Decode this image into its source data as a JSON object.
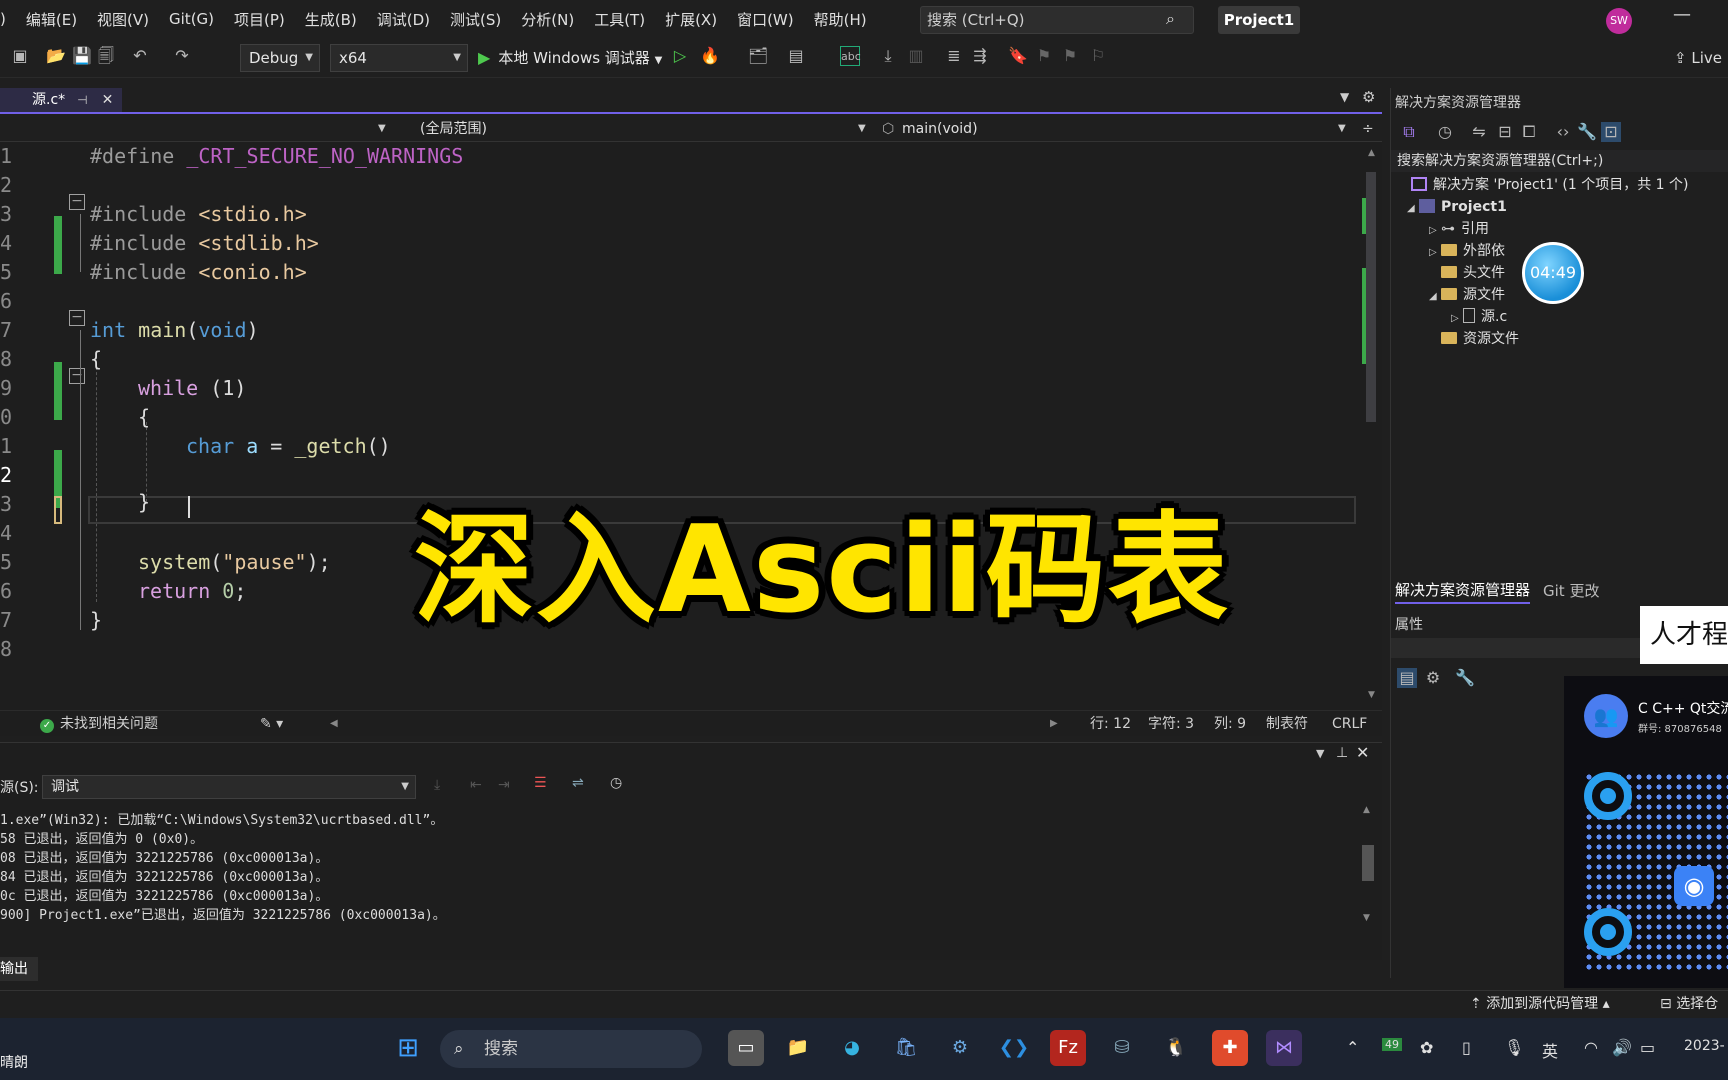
{
  "menu": {
    "items": [
      ")",
      "编辑(E)",
      "视图(V)",
      "Git(G)",
      "项目(P)",
      "生成(B)",
      "调试(D)",
      "测试(S)",
      "分析(N)",
      "工具(T)",
      "扩展(X)",
      "窗口(W)",
      "帮助(H)"
    ],
    "search_placeholder": "搜索 (Ctrl+Q)",
    "project_name": "Project1",
    "avatar_initials": "SW"
  },
  "toolbar": {
    "config": "Debug",
    "platform": "x64",
    "run_label": "本地 Windows 调试器",
    "live_share": "Live"
  },
  "editor": {
    "tab_label": "源.c*",
    "scope": "(全局范围)",
    "function": "main(void)",
    "line_numbers": [
      "1",
      "2",
      "3",
      "4",
      "5",
      "6",
      "7",
      "8",
      "9",
      "0",
      "1",
      "2",
      "3",
      "4",
      "5",
      "6",
      "7",
      "8"
    ],
    "code": {
      "l1_pre": "#define",
      "l1_macro": "_CRT_SECURE_NO_WARNINGS",
      "l3_pre": "#include",
      "l3_hdr": "<stdio.h>",
      "l4_pre": "#include",
      "l4_hdr": "<stdlib.h>",
      "l5_pre": "#include",
      "l5_hdr": "<conio.h>",
      "l7_type": "int",
      "l7_fn": "main",
      "l7_paren_open": "(",
      "l7_void": "void",
      "l7_paren_close": ")",
      "l8": "{",
      "l9_kw": "while",
      "l9_rest": " (1)",
      "l10": "{",
      "l11_type": "char",
      "l11_var": "a",
      "l11_eq": " = ",
      "l11_fn": "_getch",
      "l11_rest": "()",
      "l13": "}",
      "l15_fn": "system",
      "l15_open": "(",
      "l15_str": "\"pause\"",
      "l15_close": ");",
      "l16_kw": "return",
      "l16_num": "0",
      "l16_end": ";",
      "l17": "}"
    },
    "overlay_title": "深入Ascii码表"
  },
  "editor_status": {
    "issues": "未找到相关问题",
    "line": "行: 12",
    "char": "字符: 3",
    "col": "列: 9",
    "tabs": "制表符",
    "eol": "CRLF"
  },
  "output": {
    "source_label": "源(S):",
    "source_value": "调试",
    "lines": [
      "1.exe”(Win32): 已加载“C:\\Windows\\System32\\ucrtbased.dll”。",
      "58 已退出，返回值为 0 (0x0)。",
      "08 已退出，返回值为 3221225786 (0xc000013a)。",
      "84 已退出，返回值为 3221225786 (0xc000013a)。",
      "0c 已退出，返回值为 3221225786 (0xc000013a)。",
      "900] Project1.exe”已退出，返回值为 3221225786 (0xc000013a)。"
    ],
    "tab_label": "输出"
  },
  "solution_explorer": {
    "title": "解决方案资源管理器",
    "search": "搜索解决方案资源管理器(Ctrl+;)",
    "solution": "解决方案 'Project1' (1 个项目，共 1 个)",
    "project": "Project1",
    "nodes": [
      "引用",
      "外部依",
      "头文件",
      "源文件",
      "源.c",
      "资源文件"
    ],
    "timer": "04:49",
    "tab_explorer": "解决方案资源管理器",
    "tab_git": "Git 更改",
    "properties": "属性"
  },
  "watermark": {
    "promo": "人才程",
    "group_name": "C C++ Qt交流",
    "group_number": "群号: 870876548"
  },
  "statusbar": {
    "source_control": "添加到源代码管理",
    "select_repo": "选择仓"
  },
  "taskbar": {
    "weather": "晴朗",
    "search": "搜索",
    "badge": "49",
    "ime": "英",
    "date": "2023-"
  }
}
